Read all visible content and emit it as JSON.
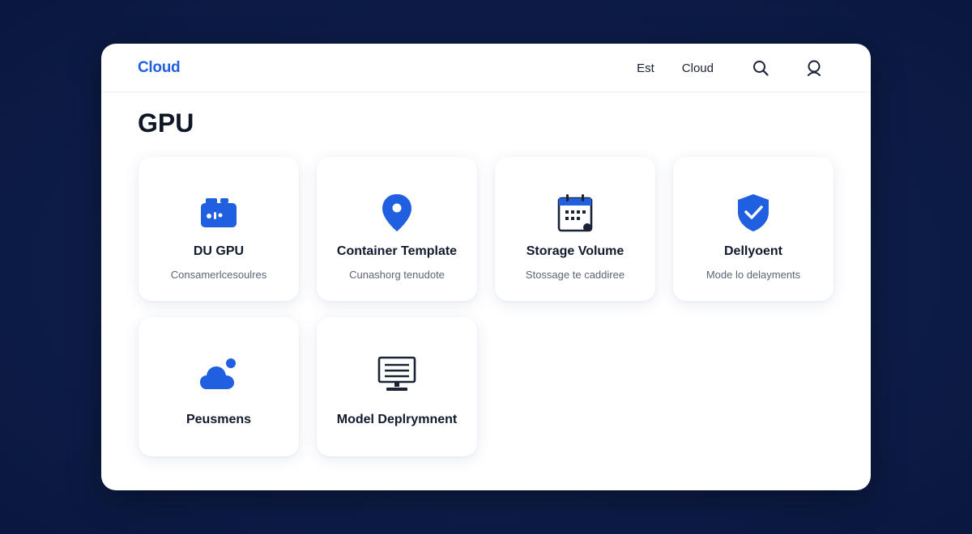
{
  "header": {
    "logo": "Cloud",
    "nav_links": [
      "Est",
      "Cloud"
    ]
  },
  "page": {
    "title": "GPU"
  },
  "cards": [
    {
      "title": "DU GPU",
      "description": "Consamerlcesoulres",
      "icon": "gpu-icon"
    },
    {
      "title": "Container Template",
      "description": "Cunashorg tenudote",
      "icon": "location-pin-icon"
    },
    {
      "title": "Storage Volume",
      "description": "Stossage te caddiree",
      "icon": "calendar-icon"
    },
    {
      "title": "Dellyoent",
      "description": "Mode lo delayments",
      "icon": "shield-check-icon"
    },
    {
      "title": "Peusmens",
      "description": "",
      "icon": "cloud-icon"
    },
    {
      "title": "Model Deplrymnent",
      "description": "",
      "icon": "monitor-icon"
    }
  ],
  "colors": {
    "accent": "#1f5fe0",
    "background": "#0e1f4d",
    "navy": "#1a2236"
  }
}
